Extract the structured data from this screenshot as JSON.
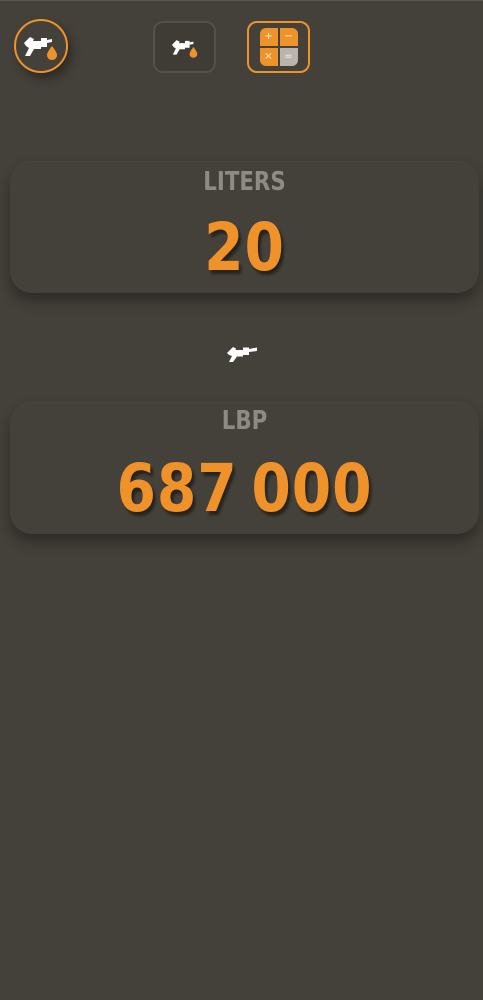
{
  "header": {
    "logo_icon": "fuel-pump-drop-icon",
    "tabs": [
      {
        "icon": "fuel-pump-drop-icon",
        "active": false
      },
      {
        "icon": "calculator-icon",
        "active": true
      }
    ],
    "calculator_symbols": [
      "+",
      "−",
      "×",
      "="
    ]
  },
  "converter": {
    "liters": {
      "label": "LITERS",
      "value": "20"
    },
    "swap_icon": "fuel-nozzle-icon",
    "lbp": {
      "label": "LBP",
      "value": "687 000"
    }
  },
  "colors": {
    "background": "#44413a",
    "accent": "#f0922a",
    "label_gray": "#8e8b86"
  }
}
